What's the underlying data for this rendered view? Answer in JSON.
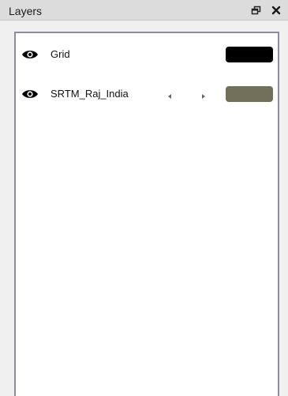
{
  "panel": {
    "title": "Layers"
  },
  "icons": {
    "float": "float-window-icon",
    "close": "close-icon",
    "visibility": "eye-icon",
    "prev": "arrow-left-icon",
    "next": "arrow-right-icon"
  },
  "layers": [
    {
      "name": "Grid",
      "color": "#000000"
    },
    {
      "name": "SRTM_Raj_India",
      "color": "#72705a"
    }
  ]
}
